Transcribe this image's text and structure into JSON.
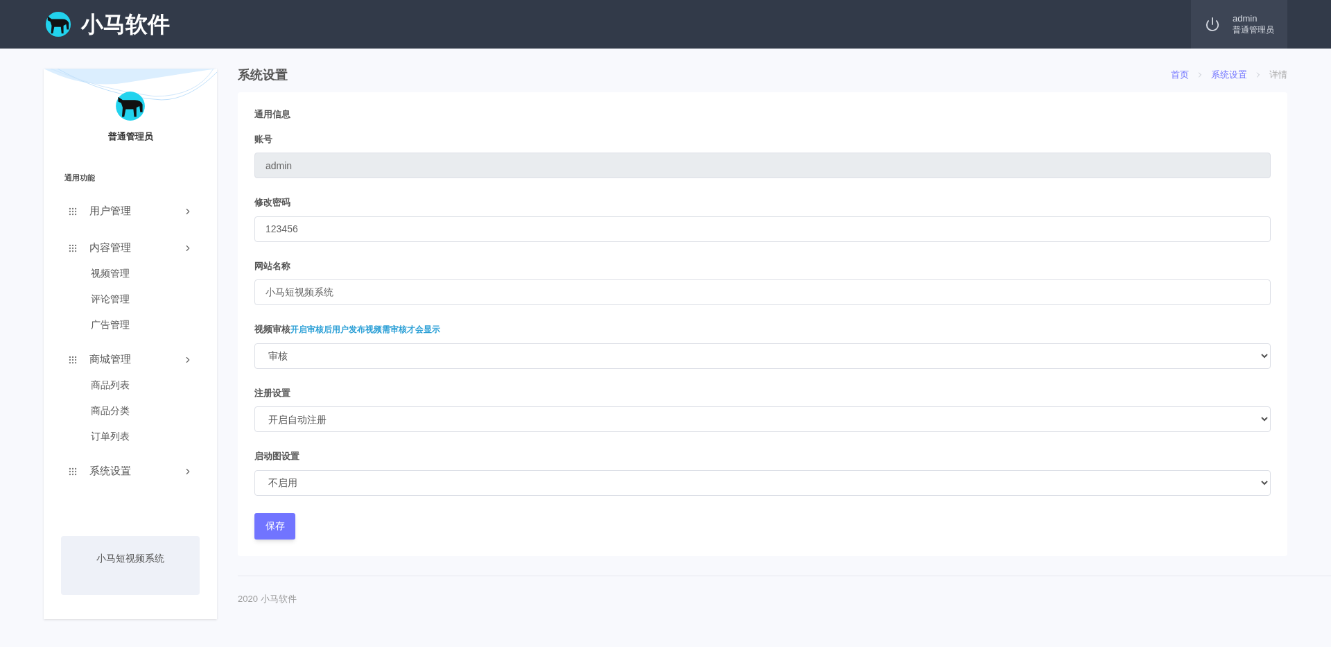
{
  "header": {
    "brand": "小马软件",
    "user": {
      "name": "admin",
      "role": "普通管理员"
    }
  },
  "sidebar": {
    "profile_name": "普通管理员",
    "section_title": "通用功能",
    "items": [
      {
        "label": "用户管理"
      },
      {
        "label": "内容管理",
        "children": [
          {
            "label": "视频管理"
          },
          {
            "label": "评论管理"
          },
          {
            "label": "广告管理"
          }
        ]
      },
      {
        "label": "商城管理",
        "children": [
          {
            "label": "商品列表"
          },
          {
            "label": "商品分类"
          },
          {
            "label": "订单列表"
          }
        ]
      },
      {
        "label": "系统设置"
      }
    ],
    "footer_card": "小马短视频系统"
  },
  "page": {
    "title": "系统设置",
    "breadcrumb": [
      {
        "label": "首页",
        "current": false
      },
      {
        "label": "系统设置",
        "current": false
      },
      {
        "label": "详情",
        "current": true
      }
    ]
  },
  "form": {
    "section_title": "通用信息",
    "fields": [
      {
        "kind": "text",
        "label": "账号",
        "value": "admin",
        "disabled": true
      },
      {
        "kind": "text",
        "label": "修改密码",
        "value": "123456",
        "disabled": false
      },
      {
        "kind": "text",
        "label": "网站名称",
        "value": "小马短视频系统",
        "disabled": false
      },
      {
        "kind": "select",
        "label": "视频审核",
        "hint": "开启审核后用户发布视频需审核才会显示",
        "value": "审核",
        "disabled": false
      },
      {
        "kind": "select",
        "label": "注册设置",
        "value": "开启自动注册",
        "disabled": false
      },
      {
        "kind": "select",
        "label": "启动图设置",
        "value": "不启用",
        "disabled": false
      }
    ],
    "save_button": "保存"
  },
  "footer": "2020 小马软件"
}
